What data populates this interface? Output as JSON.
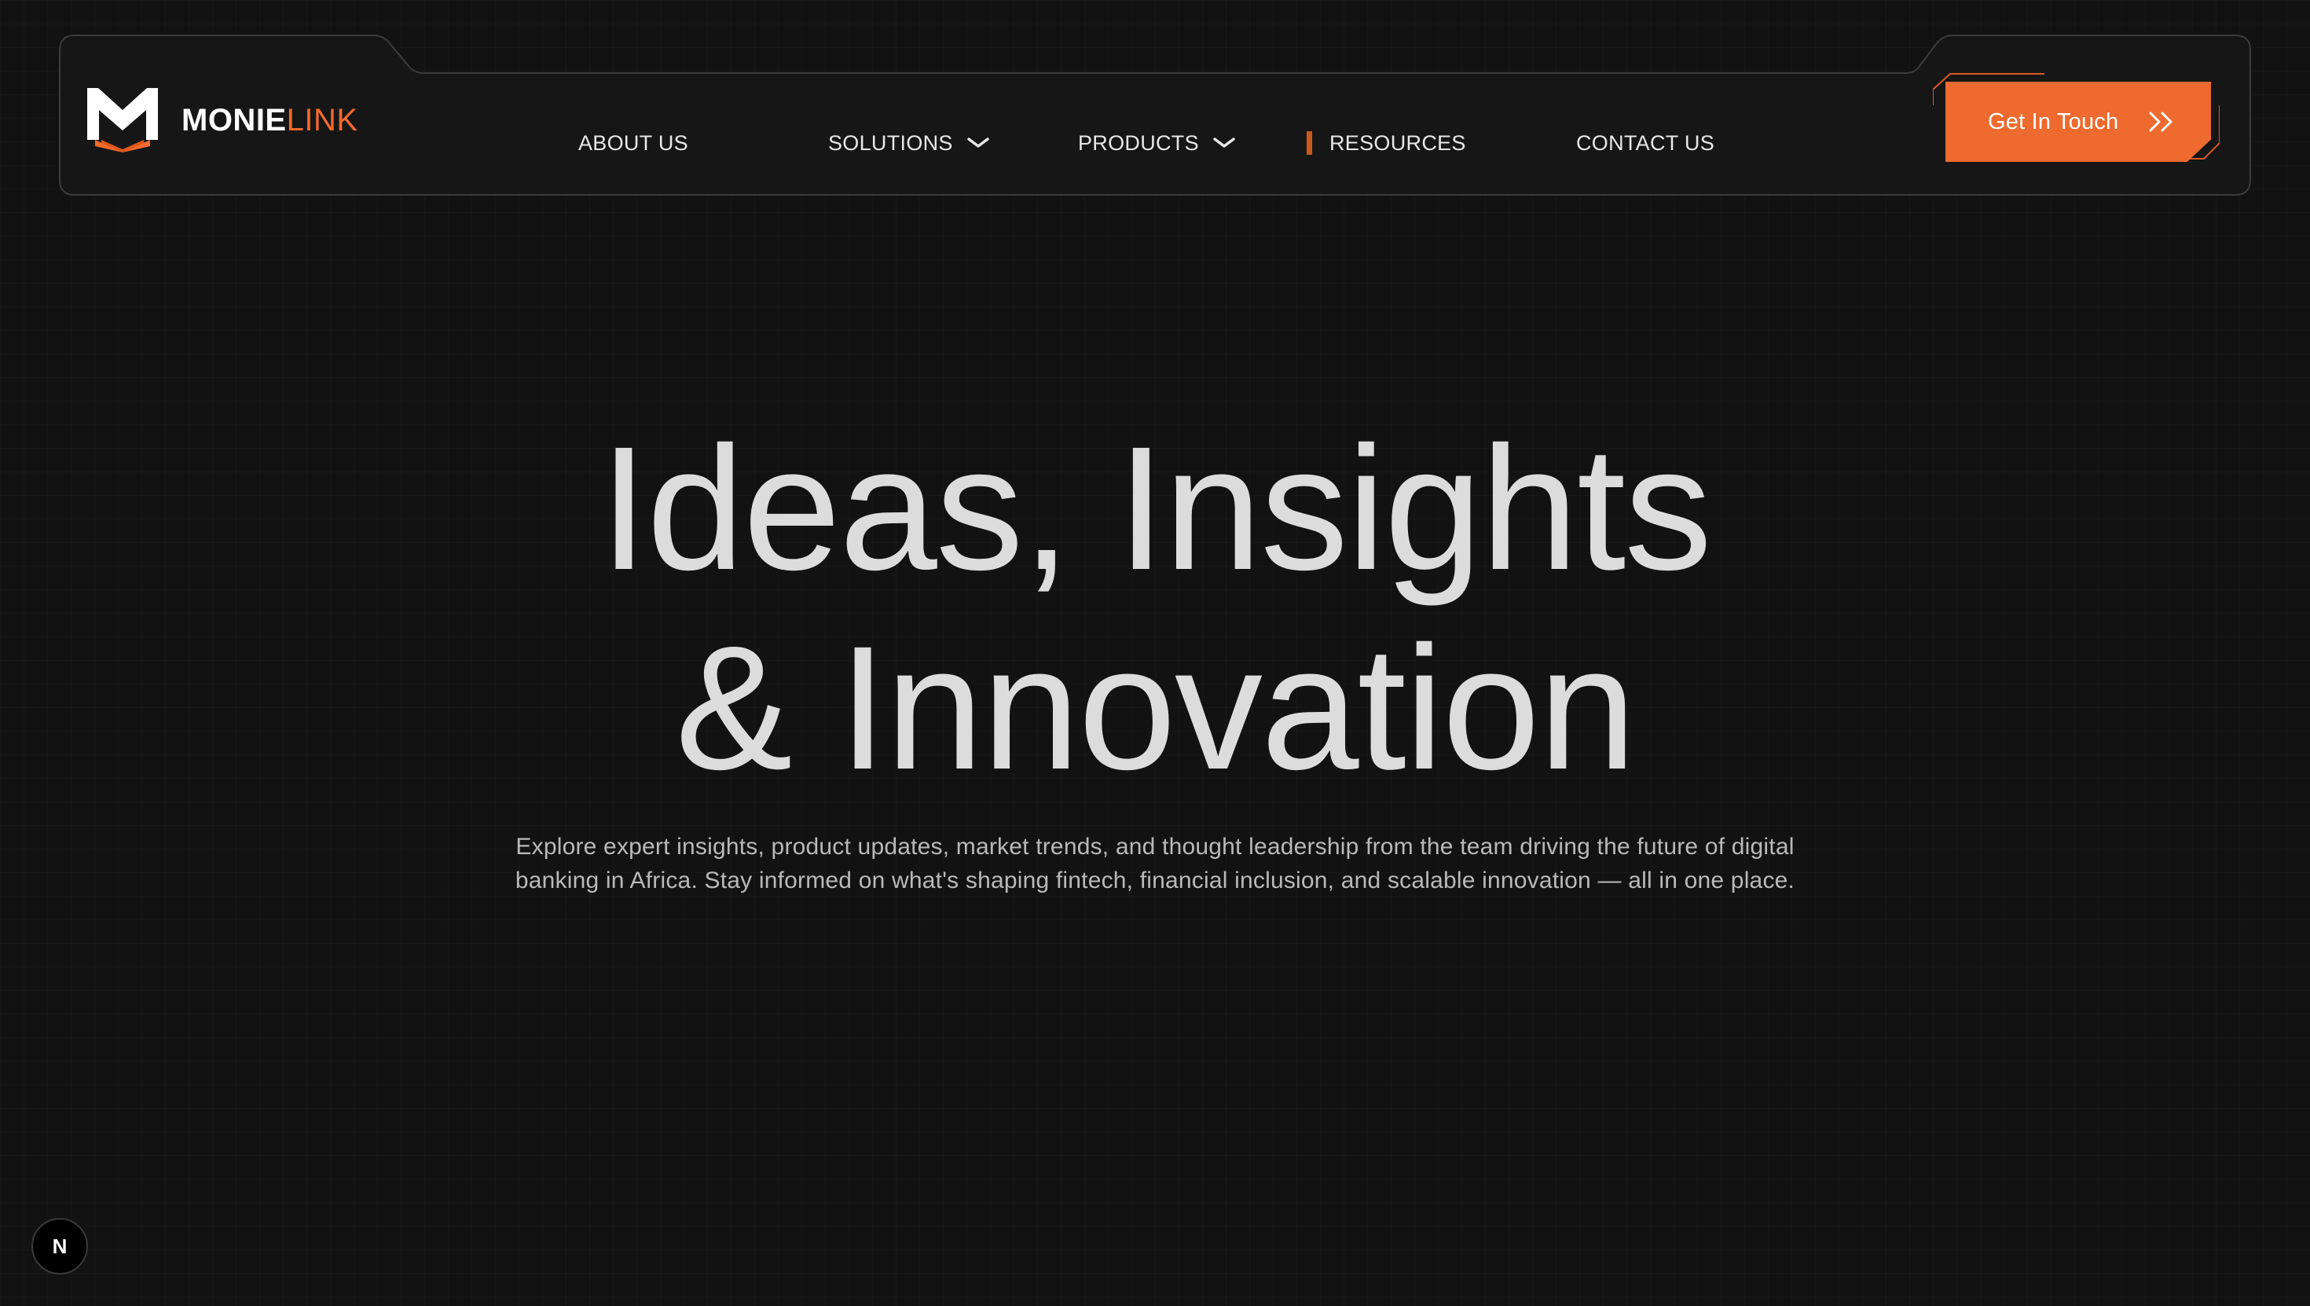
{
  "brand": {
    "name_primary": "MONIE",
    "name_accent": "LINK",
    "accent_color": "#f26a2e"
  },
  "nav": {
    "items": [
      {
        "label": "ABOUT US",
        "has_dropdown": false,
        "active": false
      },
      {
        "label": "SOLUTIONS",
        "has_dropdown": true,
        "active": false
      },
      {
        "label": "PRODUCTS",
        "has_dropdown": true,
        "active": false
      },
      {
        "label": "RESOURCES",
        "has_dropdown": false,
        "active": true
      },
      {
        "label": "CONTACT US",
        "has_dropdown": false,
        "active": false
      }
    ],
    "dropdown_icon": "chevron-down-icon"
  },
  "cta": {
    "label": "Get In Touch",
    "icon": "double-chevron-right-icon",
    "color": "#ee6a2f"
  },
  "hero": {
    "title_line1": "Ideas, Insights",
    "title_line2": "& Innovation",
    "subtitle_line1": "Explore expert insights, product updates, market trends, and thought leadership from the team driving the future of digital",
    "subtitle_line2": "banking in Africa. Stay informed on what's shaping fintech, financial inclusion, and scalable innovation — all in one place."
  },
  "badge": {
    "label": "N",
    "icon": "nextjs-icon"
  },
  "colors": {
    "background": "#121212",
    "header_border": "#3a3a3a",
    "active_indicator": "#c9581f"
  }
}
